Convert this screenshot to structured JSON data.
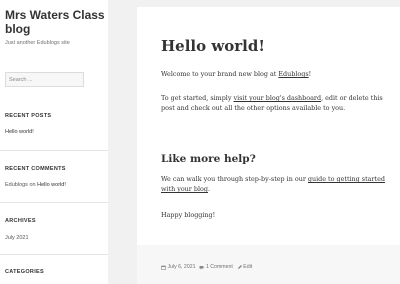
{
  "site": {
    "title": "Mrs Waters Class blog",
    "description": "Just another Edublogs site"
  },
  "search": {
    "placeholder": "Search ..."
  },
  "widgets": {
    "recent_posts": {
      "title": "RECENT POSTS",
      "items": [
        "Hello world!"
      ]
    },
    "recent_comments": {
      "title": "RECENT COMMENTS",
      "author": "Edublogs",
      "connector": "on",
      "post": "Hello world!"
    },
    "archives": {
      "title": "ARCHIVES",
      "items": [
        "July 2021"
      ]
    },
    "categories": {
      "title": "CATEGORIES"
    }
  },
  "post": {
    "title": "Hello world!",
    "p1_text": "Welcome to your brand new blog at ",
    "p1_link": "Edublogs",
    "p1_end": "!",
    "p2_start": "To get started, simply ",
    "p2_link": "visit your blog's dashboard",
    "p2_end": ", edit or delete this post and check out all the other options available to you.",
    "subheading": "Like more help?",
    "p3_start": "We can walk you through step-by-step in our ",
    "p3_link": "guide to getting started with your blog",
    "p3_end": ".",
    "p4": "Happy blogging!"
  },
  "meta": {
    "date": "July 6, 2021",
    "comments": "1 Comment",
    "edit": "Edit"
  }
}
